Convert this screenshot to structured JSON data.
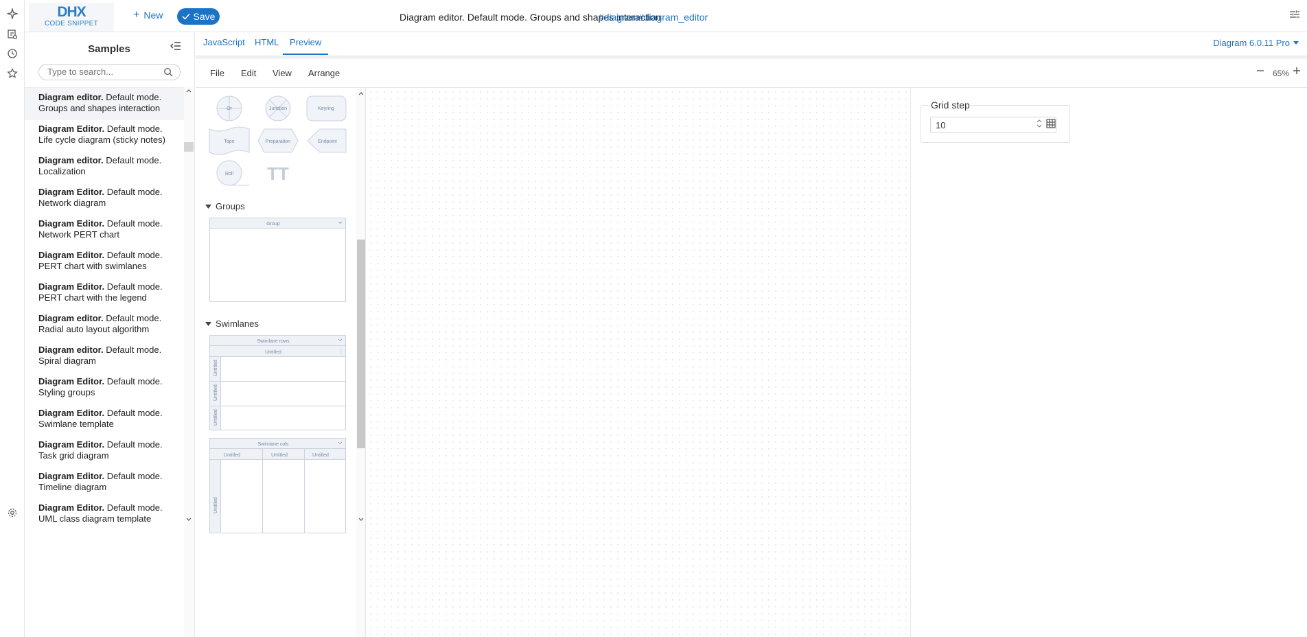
{
  "header": {
    "logo_line1": "DHX",
    "logo_line2": "CODE SNIPPET",
    "new_label": "New",
    "save_label": "Save",
    "title": "Diagram editor. Default mode. Groups and shapes interaction",
    "tags": [
      "#diagram",
      "#diagram_editor"
    ]
  },
  "rail": {
    "icons": [
      "sparkle-icon",
      "snippet-icon",
      "history-icon",
      "star-icon",
      "settings-icon"
    ]
  },
  "sidebar": {
    "title": "Samples",
    "search_placeholder": "Type to search...",
    "items": [
      {
        "bold": "Diagram editor.",
        "rest": " Default mode. Groups and shapes interaction",
        "active": true
      },
      {
        "bold": "Diagram Editor.",
        "rest": " Default mode. Life cycle diagram (sticky notes)"
      },
      {
        "bold": "Diagram editor.",
        "rest": " Default mode. Localization"
      },
      {
        "bold": "Diagram Editor.",
        "rest": " Default mode. Network diagram"
      },
      {
        "bold": "Diagram Editor.",
        "rest": " Default mode. Network PERT chart"
      },
      {
        "bold": "Diagram Editor.",
        "rest": " Default mode. PERT chart with swimlanes"
      },
      {
        "bold": "Diagram Editor.",
        "rest": " Default mode. PERT chart with the legend"
      },
      {
        "bold": "Diagram editor.",
        "rest": " Default mode. Radial auto layout algorithm"
      },
      {
        "bold": "Diagram editor.",
        "rest": " Default mode. Spiral diagram"
      },
      {
        "bold": "Diagram Editor.",
        "rest": " Default mode. Styling groups"
      },
      {
        "bold": "Diagram Editor.",
        "rest": " Default mode. Swimlane template"
      },
      {
        "bold": "Diagram Editor.",
        "rest": " Default mode. Task grid diagram"
      },
      {
        "bold": "Diagram Editor.",
        "rest": " Default mode. Timeline diagram"
      },
      {
        "bold": "Diagram Editor.",
        "rest": " Default mode. UML class diagram template"
      }
    ]
  },
  "tabs": {
    "items": [
      "JavaScript",
      "HTML",
      "Preview"
    ],
    "active": "Preview",
    "version": "Diagram 6.0.11 Pro"
  },
  "editor": {
    "menu": [
      "File",
      "Edit",
      "View",
      "Arrange"
    ],
    "zoom": "65%",
    "shapes": {
      "labels": [
        "Or",
        "Junction",
        "Keyring",
        "Tape",
        "Preparation",
        "Endpoint",
        "Roll"
      ],
      "text_glyph": "TT"
    },
    "groups_title": "Groups",
    "group_label": "Group",
    "swimlanes_title": "Swimlanes",
    "swimlane_rows_label": "Swimlane rows",
    "swimlane_cols_label": "Swimlane cols",
    "untitled": "Untitled"
  },
  "panel": {
    "grid_step_label": "Grid step",
    "grid_step_value": "10"
  }
}
